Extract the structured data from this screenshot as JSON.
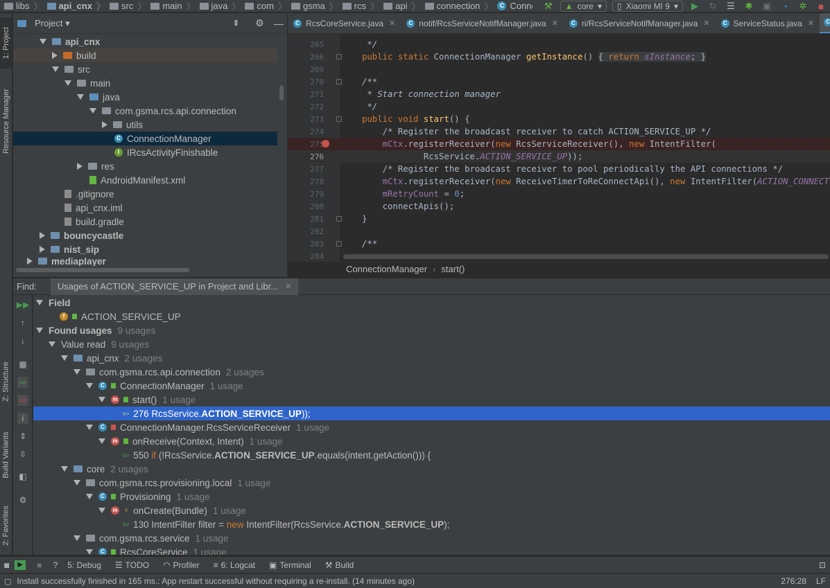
{
  "navbar": {
    "crumbs": [
      "libs",
      "api_cnx",
      "src",
      "main",
      "java",
      "com",
      "gsma",
      "rcs",
      "api",
      "connection",
      "ConnectionManager"
    ],
    "run_config": "core",
    "device": "Xiaomi MI 9"
  },
  "left_strip": {
    "project": "1: Project",
    "resource_manager": "Resource Manager",
    "structure": "Z: Structure",
    "build_variants": "Build Variants",
    "favorites": "2: Favorites"
  },
  "project": {
    "title": "Project",
    "tree": [
      {
        "label": "api_cnx",
        "bold": true
      },
      {
        "label": "build"
      },
      {
        "label": "src"
      },
      {
        "label": "main"
      },
      {
        "label": "java"
      },
      {
        "label": "com.gsma.rcs.api.connection"
      },
      {
        "label": "utils"
      },
      {
        "label": "ConnectionManager"
      },
      {
        "label": "IRcsActivityFinishable"
      },
      {
        "label": "res"
      },
      {
        "label": "AndroidManifest.xml"
      },
      {
        "label": ".gitignore"
      },
      {
        "label": "api_cnx.iml"
      },
      {
        "label": "build.gradle"
      },
      {
        "label": "bouncycastle",
        "bold": true
      },
      {
        "label": "nist_sip",
        "bold": true
      },
      {
        "label": "mediaplayer",
        "bold": true
      }
    ]
  },
  "editor": {
    "tabs": [
      {
        "label": "RcsCoreService.java"
      },
      {
        "label": "notif/RcsServiceNotifManager.java"
      },
      {
        "label": "ri/RcsServiceNotifManager.java"
      },
      {
        "label": "ServiceStatus.java"
      }
    ],
    "line_numbers": [
      "265",
      "266",
      "269",
      "270",
      "271",
      "272",
      "273",
      "274",
      "275",
      "276",
      "277",
      "278",
      "279",
      "280",
      "281",
      "282",
      "283",
      "284"
    ],
    "breadcrumb": [
      "ConnectionManager",
      "start()"
    ]
  },
  "find": {
    "label": "Find:",
    "tab": "Usages of ACTION_SERVICE_UP in Project and Libr...",
    "tree": {
      "field_header": "Field",
      "field_name": "ACTION_SERVICE_UP",
      "found_usages": "Found usages",
      "found_count": "9 usages",
      "value_read": "Value read",
      "value_read_count": "9 usages",
      "api_cnx": "api_cnx",
      "api_cnx_count": "2 usages",
      "pkg_connection": "com.gsma.rcs.api.connection",
      "pkg_connection_count": "2 usages",
      "cls_connection_manager": "ConnectionManager",
      "cls_connection_manager_count": "1 usage",
      "method_start": "start()",
      "method_start_count": "1 usage",
      "usage_276_line": "276",
      "usage_276_pre": "RcsService.",
      "usage_276_bold": "ACTION_SERVICE_UP",
      "usage_276_post": "));",
      "cls_receiver": "ConnectionManager.RcsServiceReceiver",
      "cls_receiver_count": "1 usage",
      "method_onreceive": "onReceive(Context, Intent)",
      "method_onreceive_count": "1 usage",
      "usage_550_line": "550",
      "usage_550_kw": "if",
      "usage_550_pre": "(!RcsService.",
      "usage_550_bold": "ACTION_SERVICE_UP",
      "usage_550_post": ".equals(intent.getAction())) {",
      "core": "core",
      "core_count": "2 usages",
      "pkg_provisioning": "com.gsma.rcs.provisioning.local",
      "pkg_provisioning_count": "1 usage",
      "cls_provisioning": "Provisioning",
      "cls_provisioning_count": "1 usage",
      "method_oncreate": "onCreate(Bundle)",
      "method_oncreate_count": "1 usage",
      "usage_130_line": "130",
      "usage_130_pre": "IntentFilter filter =",
      "usage_130_kw": "new",
      "usage_130_mid": "IntentFilter(RcsService.",
      "usage_130_bold": "ACTION_SERVICE_UP",
      "usage_130_post": ");",
      "pkg_service": "com.gsma.rcs.service",
      "pkg_service_count": "1 usage",
      "cls_core_service": "RcsCoreService",
      "cls_core_service_count": "1 usage"
    }
  },
  "bottom_tools": [
    "5: Debug",
    "TODO",
    "Profiler",
    "6: Logcat",
    "Terminal",
    "Build"
  ],
  "status": {
    "message": "Install successfully finished in 165 ms.: App restart successful without requiring a re-install. (14 minutes ago)",
    "position": "276:28",
    "line_ending": "LF"
  },
  "colors": {
    "selection_blue": "#2f65ca",
    "panel_bg": "#3c3f41",
    "editor_bg": "#2b2b2b",
    "breakpoint": "#c75450"
  }
}
